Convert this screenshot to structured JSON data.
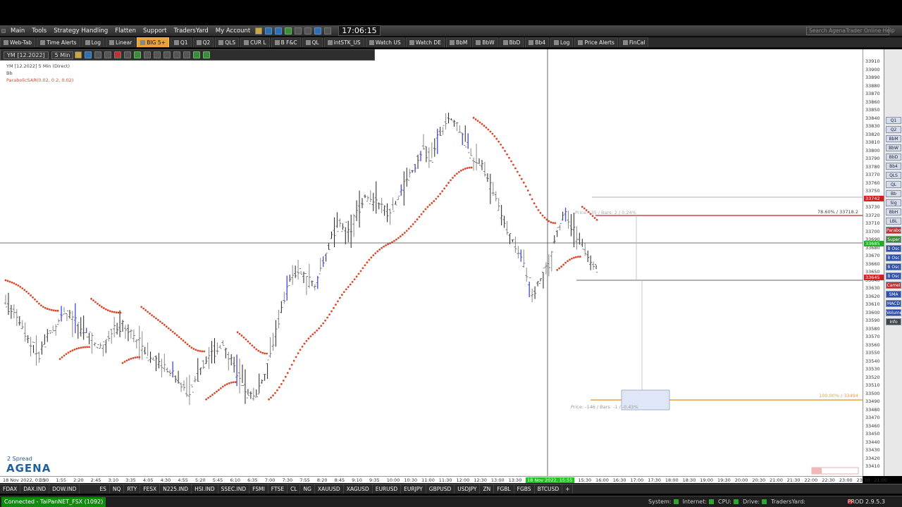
{
  "menu": {
    "items": [
      "Main",
      "Tools",
      "Strategy Handling",
      "Flatten",
      "Support",
      "TradersYard",
      "My Account"
    ],
    "clock": "17:06:15",
    "search_placeholder": "Search AgenaTrader Online Help"
  },
  "workspace_tabs": [
    "Web-Tab",
    "Time Alerts",
    "Log",
    "Linear",
    "BIG 5+",
    "Q1",
    "Q2",
    "QLS",
    "CUR L",
    "B F&C",
    "QL",
    "intSTK_US",
    "Watch US",
    "Watch DE",
    "BbM",
    "BbW",
    "BbD",
    "Bb4",
    "Log",
    "Price Alerts",
    "FinCal"
  ],
  "active_tab_index": 4,
  "chart_toolbar": {
    "instrument": "YM [12.2022]",
    "timeframe": "5 Min"
  },
  "chart_legend": {
    "title": "YM [12.2022]  5 Min (Direct)",
    "line2": "Bb",
    "indicator": "ParabolicSAR(0.02, 0.2, 0.02)"
  },
  "annotations": {
    "fib_top": "78.60% / 33718.2",
    "fib_bottom": "100.00% / 33494",
    "measure_top": "Price: -35 / Bars: 2 / 0.24%",
    "measure_bottom": "Price: -146 / Bars: -1 / -0.43%",
    "spread": "2 Spread",
    "logo": "AGENA"
  },
  "y_axis": {
    "ticks": [
      "33910",
      "33900",
      "33890",
      "33880",
      "33870",
      "33860",
      "33850",
      "33840",
      "33830",
      "33820",
      "33810",
      "33800",
      "33790",
      "33780",
      "33770",
      "33760",
      "33750",
      "33740",
      "33730",
      "33720",
      "33710",
      "33700",
      "33690",
      "33680",
      "33670",
      "33660",
      "33650",
      "33640",
      "33630",
      "33620",
      "33610",
      "33600",
      "33590",
      "33580",
      "33570",
      "33560",
      "33550",
      "33540",
      "33530",
      "33520",
      "33510",
      "33500",
      "33490",
      "33480",
      "33470",
      "33460",
      "33450",
      "33440",
      "33430",
      "33420",
      "33410"
    ],
    "price_marks": {
      "red_top": "33742",
      "green": "33685",
      "red_low": "33645"
    }
  },
  "x_axis": {
    "ticks": [
      "18 Nov 2022, 0:05",
      "1:30",
      "1:55",
      "2:20",
      "2:45",
      "3:10",
      "3:35",
      "4:05",
      "4:30",
      "4:55",
      "5:20",
      "5:45",
      "6:10",
      "6:35",
      "7:00",
      "7:30",
      "7:55",
      "8:20",
      "8:45",
      "9:10",
      "9:35",
      "10:00",
      "10:30",
      "11:00",
      "11:30",
      "12:00",
      "12:30",
      "13:00",
      "13:30",
      "14:00",
      "14:30",
      "15:00",
      "15:30",
      "16:00",
      "16:30",
      "17:00",
      "17:30",
      "18:00",
      "18:30",
      "19:00",
      "19:30",
      "20:00",
      "20:30",
      "21:00",
      "21:30",
      "22:00",
      "22:30",
      "23:00",
      "23:30",
      "21:00"
    ],
    "highlight": "18 Nov 2022, 15:55"
  },
  "right_panel": [
    "Q1",
    "Q2",
    "BbM",
    "BbW",
    "BbD",
    "Bb4",
    "QLS",
    "QL",
    "Bb",
    "Sig",
    "BbH",
    "LBL",
    "Parabo",
    "Super",
    "B Osc",
    "B Osc",
    "B Osc",
    "B Osc",
    "Camel",
    "SMA",
    "MACD",
    "Volume",
    "Info"
  ],
  "instrument_tabs": [
    "FDAX",
    "DAX.IND",
    "DOW.IND",
    "",
    "ES",
    "NQ",
    "RTY",
    "FESX",
    "N225.IND",
    "HSI.IND",
    "SSEC.IND",
    "FSMI",
    "FTSE",
    "CL",
    "NG",
    "XAUUSD",
    "XAGUSD",
    "EURUSD",
    "EURJPY",
    "GBPUSD",
    "USDJPY",
    "ZN",
    "FGBL",
    "FGBS",
    "BTCUSD",
    "+"
  ],
  "active_instrument_index": 3,
  "status": {
    "connection": "Connected - TaiPanNET_FSX (1092)",
    "system": "System:",
    "internet": "Internet:",
    "cpu": "CPU:",
    "drive": "Drive:",
    "tradersyard": "TradersYard:",
    "version": "PROD 2.9.5.3"
  },
  "colors": {
    "sar": "#d9482b",
    "bull": "#4d55d9",
    "fib": "#e8a23a",
    "accent": "#e8a23a",
    "connected": "#128a12"
  },
  "chart_data": {
    "type": "candlestick",
    "instrument": "YM [12.2022]",
    "timeframe": "5 Min",
    "ylim": [
      33405,
      33915
    ],
    "sar_color": "#d9482b",
    "series": [
      {
        "values": [
          33610,
          33600,
          33580,
          33560,
          33545,
          33570,
          33580,
          33600,
          33590,
          33580,
          33570,
          33555,
          33560,
          33575,
          33585,
          33575,
          33560,
          33545,
          33540,
          33530,
          33520,
          33510,
          33500,
          33520,
          33540,
          33550,
          33560,
          33540,
          33520,
          33500,
          33495,
          33520,
          33560,
          33600,
          33640,
          33650,
          33640,
          33630,
          33660,
          33690,
          33710,
          33700,
          33720,
          33740,
          33735,
          33730,
          33720,
          33740,
          33760,
          33780,
          33800,
          33790,
          33820,
          33840,
          33830,
          33810,
          33790,
          33780,
          33760,
          33730,
          33700,
          33680,
          33660,
          33620,
          33640,
          33660,
          33700,
          33720,
          33700,
          33680,
          33660,
          33650
        ]
      }
    ]
  }
}
